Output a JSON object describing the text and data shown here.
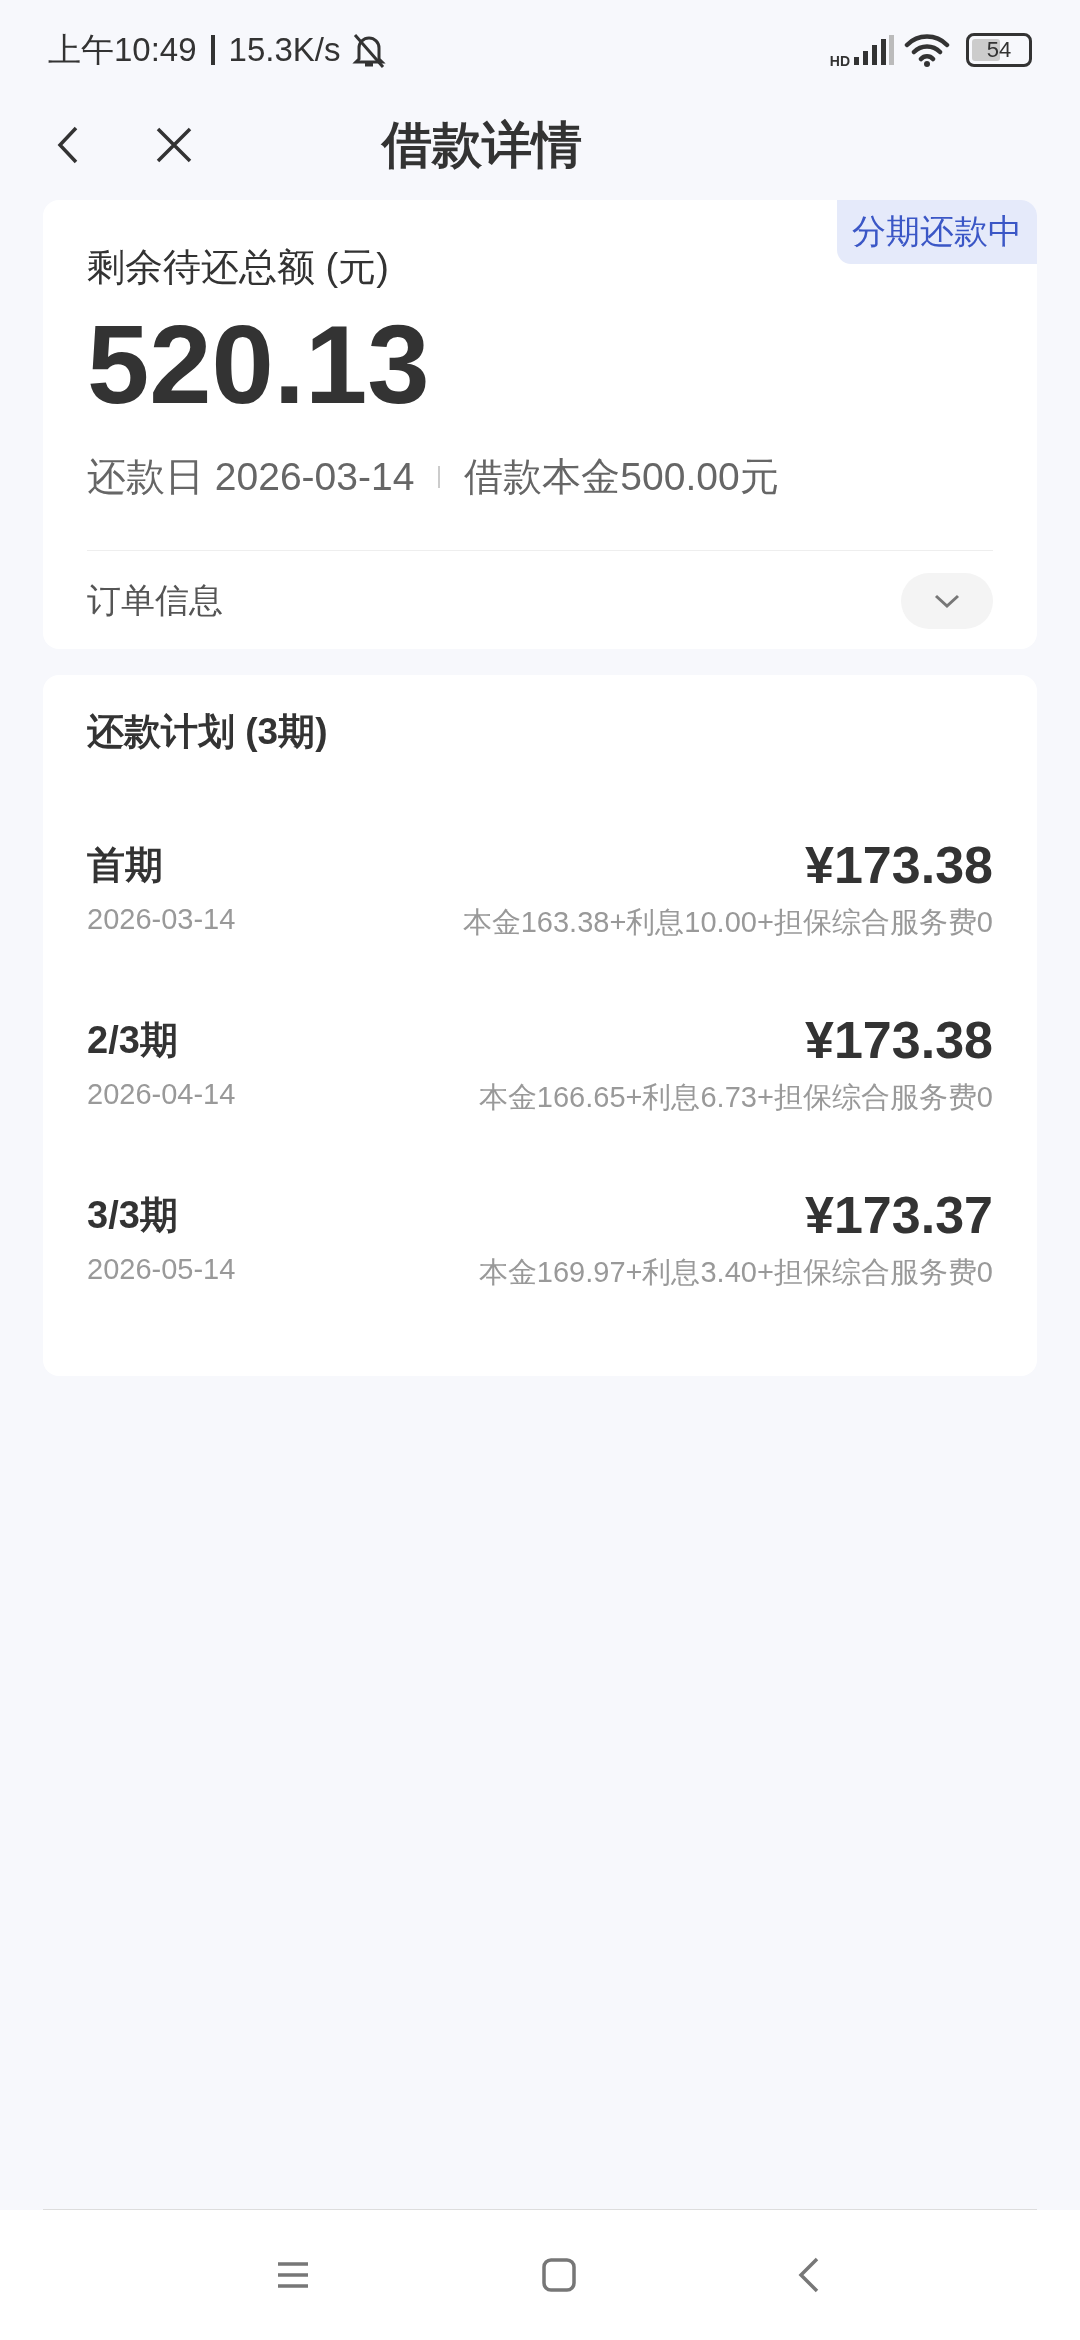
{
  "status_bar": {
    "time": "上午10:49",
    "speed": "15.3K/s",
    "network": "HD",
    "battery": "54"
  },
  "nav": {
    "title": "借款详情"
  },
  "summary": {
    "badge": "分期还款中",
    "label": "剩余待还总额 (元)",
    "amount": "520.13",
    "due": "还款日 2026-03-14",
    "principal": "借款本金500.00元",
    "order_info": {
      "label": "订单信息",
      "expanded": false
    }
  },
  "plan": {
    "title": "还款计划 (3期)",
    "rows": [
      {
        "period": "首期",
        "amount": "¥173.38",
        "date": "2026-03-14",
        "detail": "本金163.38+利息10.00+担保综合服务费0"
      },
      {
        "period": "2/3期",
        "amount": "¥173.38",
        "date": "2026-04-14",
        "detail": "本金166.65+利息6.73+担保综合服务费0"
      },
      {
        "period": "3/3期",
        "amount": "¥173.37",
        "date": "2026-05-14",
        "detail": "本金169.97+利息3.40+担保综合服务费0"
      }
    ]
  }
}
